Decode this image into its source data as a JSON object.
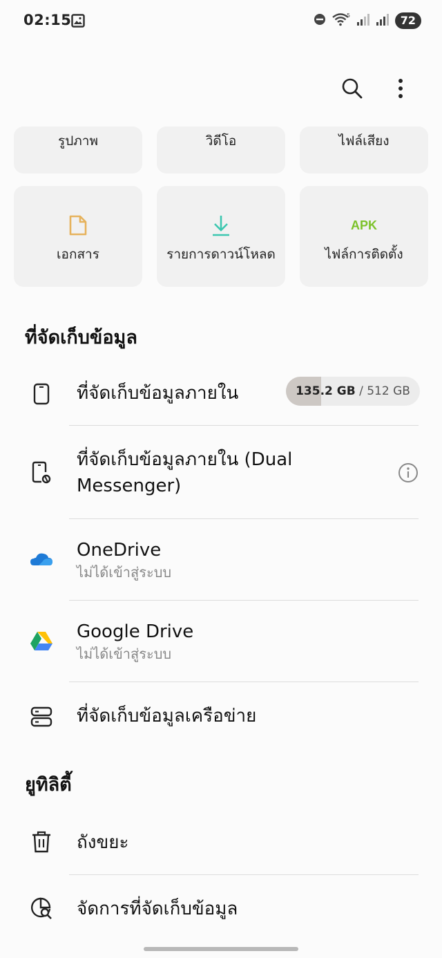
{
  "status_bar": {
    "time": "02:15",
    "battery": "72"
  },
  "categories": {
    "row1": [
      {
        "label": "รูปภาพ"
      },
      {
        "label": "วิดีโอ"
      },
      {
        "label": "ไฟล์เสียง"
      }
    ],
    "row2": [
      {
        "label": "เอกสาร",
        "icon": "document-icon",
        "color": "#e6b25c"
      },
      {
        "label": "รายการดาวน์โหลด",
        "icon": "download-icon",
        "color": "#3cc7b0"
      },
      {
        "label": "ไฟล์การติดตั้ง",
        "icon_text": "APK",
        "color": "#7cc22a"
      }
    ]
  },
  "storage": {
    "title": "ที่จัดเก็บข้อมูล",
    "items": [
      {
        "title": "ที่จัดเก็บข้อมูลภายใน",
        "used": "135.2 GB",
        "total": "/ 512 GB",
        "used_fraction": 0.264,
        "icon": "phone-icon"
      },
      {
        "title": "ที่จัดเก็บข้อมูลภายใน (Dual Messenger)",
        "icon": "dual-messenger-phone-icon"
      },
      {
        "title": "OneDrive",
        "subtitle": "ไม่ได้เข้าสู่ระบบ",
        "icon": "onedrive-icon"
      },
      {
        "title": "Google Drive",
        "subtitle": "ไม่ได้เข้าสู่ระบบ",
        "icon": "google-drive-icon"
      },
      {
        "title": "ที่จัดเก็บข้อมูลเครือข่าย",
        "icon": "network-storage-icon"
      }
    ]
  },
  "utilities": {
    "title": "ยูทิลิตี้",
    "items": [
      {
        "title": "ถังขยะ",
        "icon": "trash-icon"
      },
      {
        "title": "จัดการที่จัดเก็บข้อมูล",
        "icon": "manage-storage-icon"
      }
    ]
  }
}
